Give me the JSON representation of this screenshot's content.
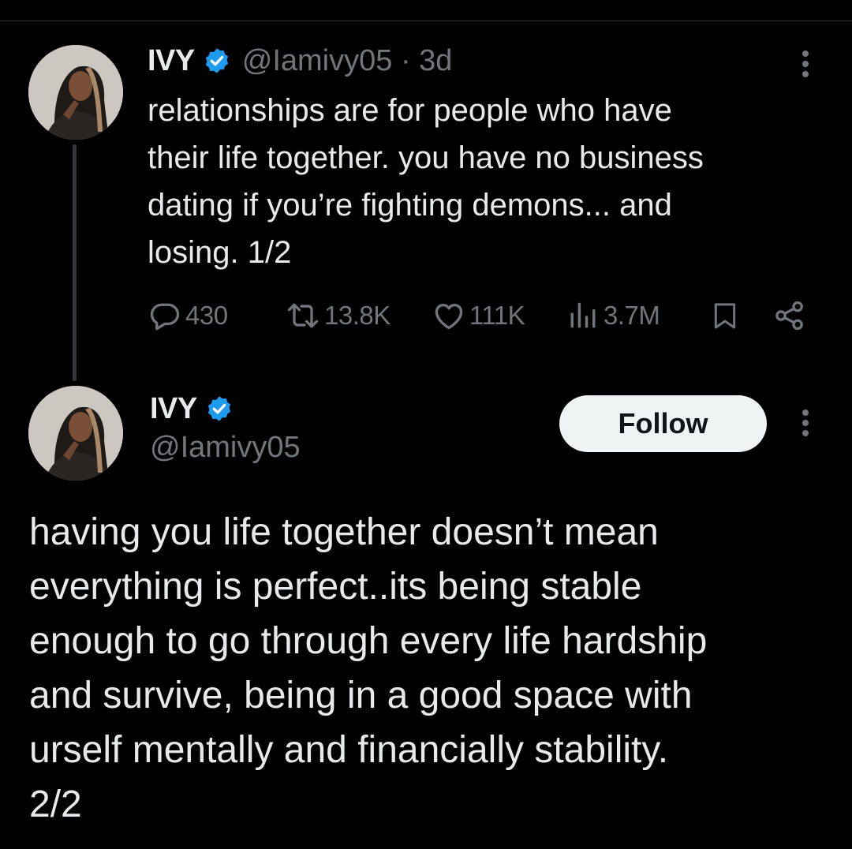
{
  "colors": {
    "background": "#000000",
    "text_primary": "#e7e9ea",
    "text_secondary": "#71767b",
    "verified_blue": "#1d9bf0",
    "follow_button_bg": "#eff3f4",
    "follow_button_text": "#0f1419"
  },
  "tweet1": {
    "author": {
      "display_name": "IVY",
      "verified_icon": "verified-badge-icon",
      "handle": "@Iamivy05",
      "separator": "·",
      "time": "3d"
    },
    "more_icon": "more-options-icon",
    "text": "relationships are for people who have\ntheir life together. you have no business\ndating if you’re fighting demons... and\nlosing. 1/2",
    "actions": {
      "reply": {
        "icon": "reply-icon",
        "count": "430"
      },
      "retweet": {
        "icon": "retweet-icon",
        "count": "13.8K"
      },
      "like": {
        "icon": "heart-icon",
        "count": "111K"
      },
      "views": {
        "icon": "views-chart-icon",
        "count": "3.7M"
      },
      "bookmark": {
        "icon": "bookmark-icon"
      },
      "share": {
        "icon": "share-icon"
      }
    }
  },
  "tweet2": {
    "author": {
      "display_name": "IVY",
      "verified_icon": "verified-badge-icon",
      "handle": "@Iamivy05"
    },
    "follow_label": "Follow",
    "more_icon": "more-options-icon",
    "text": "having you life together doesn’t mean\neverything is perfect..its being stable\nenough to go through every life hardship\nand survive, being in a good space with\nurself mentally and financially stability.\n2/2"
  }
}
